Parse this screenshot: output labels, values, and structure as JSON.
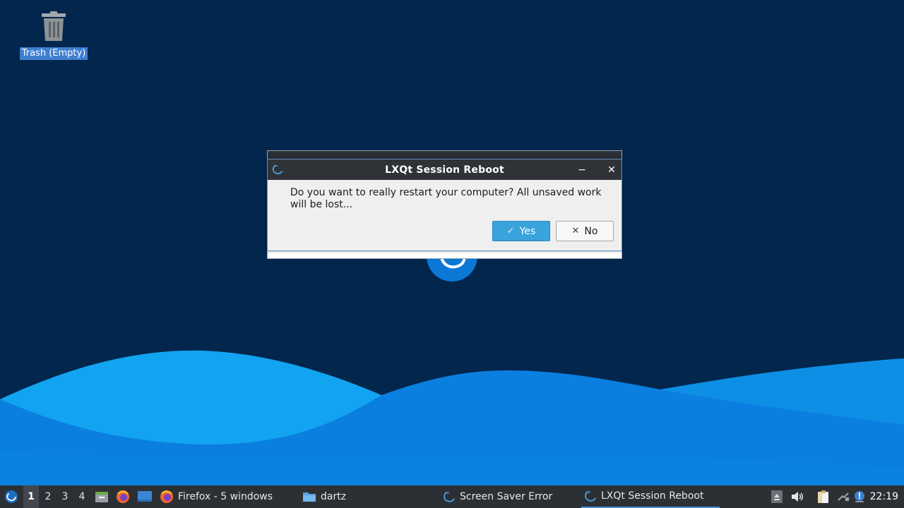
{
  "desktop": {
    "icons": [
      {
        "label": "Trash (Empty)",
        "icon": "trash-icon"
      }
    ]
  },
  "background_window": {
    "title": "Screen Saver Error"
  },
  "dialog": {
    "title": "LXQt Session Reboot",
    "message": "Do you want to really restart your computer? All unsaved work will be lost...",
    "yes_label": "Yes",
    "no_label": "No",
    "yes_icon": "checkmark-icon",
    "no_icon": "x-icon"
  },
  "panel": {
    "desktops": [
      "1",
      "2",
      "3",
      "4"
    ],
    "active_desktop": "1",
    "quicklaunch": [
      "file-manager-icon",
      "firefox-icon",
      "show-desktop-icon"
    ],
    "tasks": [
      {
        "label": "Firefox - 5 windows",
        "icon": "firefox-icon",
        "active": false
      },
      {
        "label": "dartz",
        "icon": "folder-icon",
        "active": false
      },
      {
        "label": "Screen Saver Error",
        "icon": "lxqt-icon",
        "active": false
      },
      {
        "label": "LXQt Session Reboot",
        "icon": "lxqt-icon",
        "active": true
      }
    ],
    "tray": [
      "eject-icon",
      "volume-icon",
      "clipboard-icon",
      "network-icon",
      "notification-icon"
    ],
    "clock": "22:19"
  },
  "colors": {
    "desktop_bg": "#03264d",
    "accent": "#3aa3db",
    "panel_bg": "#2c3034",
    "titlebar_bg": "#2f3338"
  }
}
